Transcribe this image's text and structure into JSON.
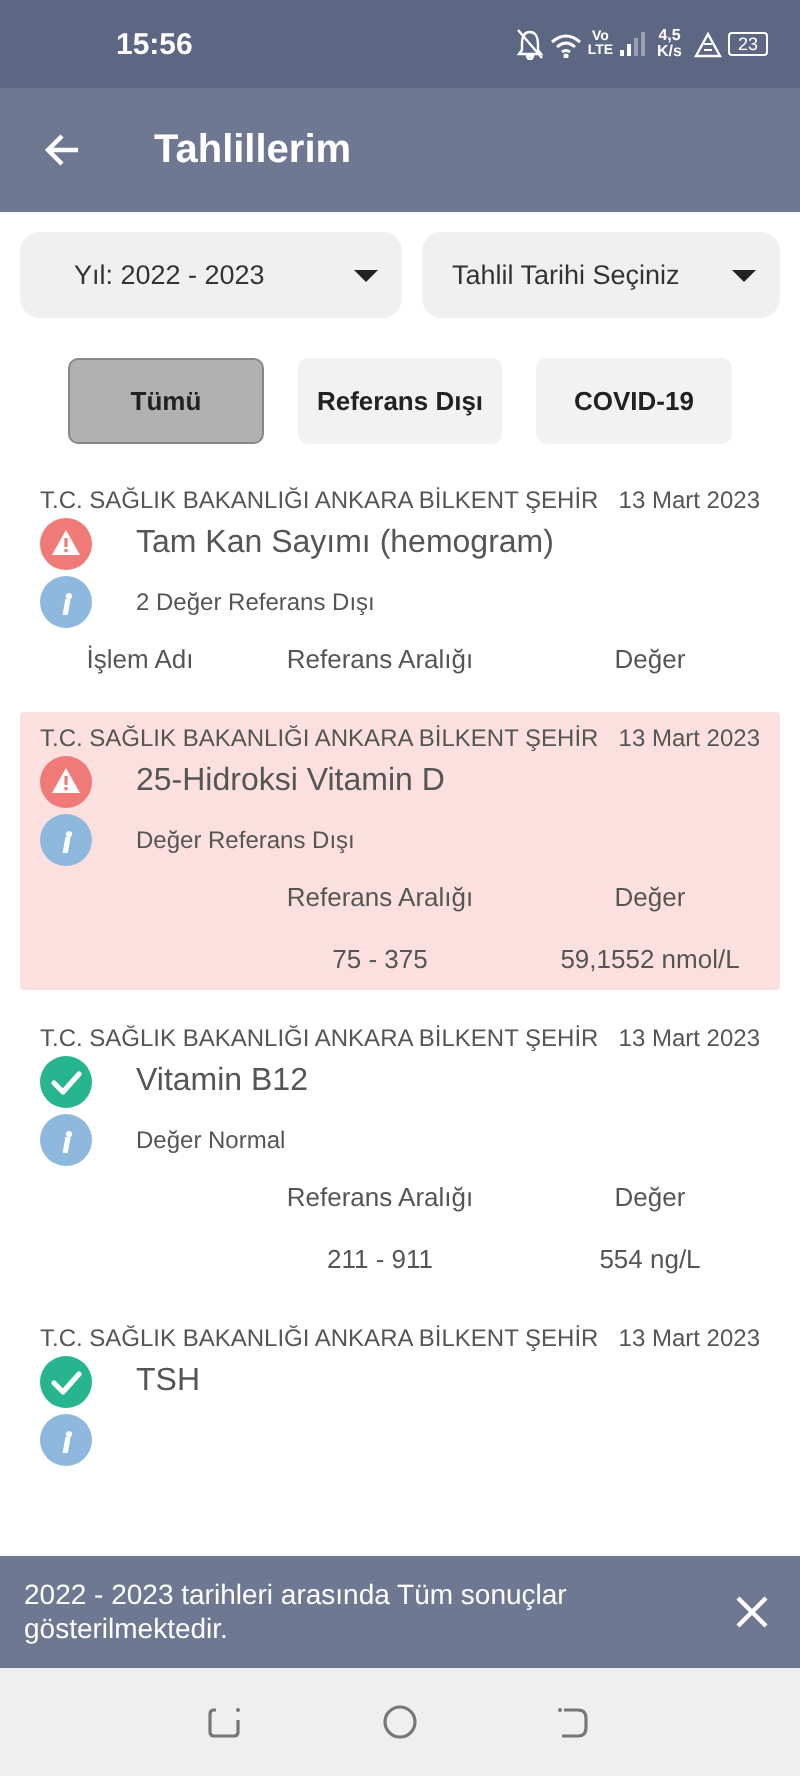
{
  "status_bar": {
    "time": "15:56",
    "network_top": "Vo",
    "network_bottom": "LTE",
    "speed_value": "4,5",
    "speed_unit": "K/s",
    "battery": "23"
  },
  "app_bar": {
    "title": "Tahlillerim"
  },
  "filters": [
    {
      "label": "Yıl: 2022 - 2023"
    },
    {
      "label": "Tahlil Tarihi Seçiniz"
    }
  ],
  "chips": [
    {
      "label": "Tümü",
      "selected": true
    },
    {
      "label": "Referans Dışı",
      "selected": false
    },
    {
      "label": "COVID-19",
      "selected": false
    }
  ],
  "results": [
    {
      "hospital": "T.C. SAĞLIK BAKANLIĞI ANKARA BİLKENT ŞEHİR",
      "date": "13 Mart 2023",
      "title": "Tam Kan Sayımı (hemogram)",
      "kind": "warning",
      "highlighted": false,
      "summary": "2 Değer Referans Dışı",
      "columns": [
        "İşlem Adı",
        "Referans Aralığı",
        "Değer"
      ]
    },
    {
      "hospital": "T.C. SAĞLIK BAKANLIĞI ANKARA BİLKENT ŞEHİR",
      "date": "13 Mart 2023",
      "title": "25-Hidroksi Vitamin D",
      "kind": "warning",
      "highlighted": true,
      "summary": "Değer Referans Dışı",
      "columns": [
        "Referans Aralığı",
        "Değer"
      ],
      "rows": [
        [
          "75 - 375",
          "59,1552 nmol/L"
        ]
      ]
    },
    {
      "hospital": "T.C. SAĞLIK BAKANLIĞI ANKARA BİLKENT ŞEHİR",
      "date": "13 Mart 2023",
      "title": "Vitamin B12",
      "kind": "normal",
      "highlighted": false,
      "summary": "Değer Normal",
      "columns": [
        "Referans Aralığı",
        "Değer"
      ],
      "rows": [
        [
          "211 - 911",
          "554 ng/L"
        ]
      ]
    },
    {
      "hospital": "T.C. SAĞLIK BAKANLIĞI ANKARA BİLKENT ŞEHİR",
      "date": "13 Mart 2023",
      "title": "TSH",
      "kind": "normal",
      "highlighted": false
    }
  ],
  "snackbar": {
    "message": "2022 - 2023 tarihleri arasında Tüm sonuçlar gösterilmektedir."
  }
}
